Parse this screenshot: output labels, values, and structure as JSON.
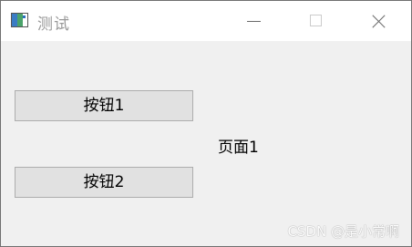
{
  "window": {
    "title": "测试"
  },
  "buttons": {
    "button1_label": "按钮1",
    "button2_label": "按钮2"
  },
  "content": {
    "page_label": "页面1"
  },
  "watermark": {
    "text": "CSDN @是小常啊"
  },
  "icons": {
    "app": "app-icon",
    "minimize": "minimize-icon",
    "maximize": "maximize-icon",
    "close": "close-icon"
  },
  "colors": {
    "window_background": "#f0f0f0",
    "titlebar_background": "#ffffff",
    "button_background": "#e1e1e1",
    "button_border": "#adadad",
    "title_text": "#999999"
  }
}
